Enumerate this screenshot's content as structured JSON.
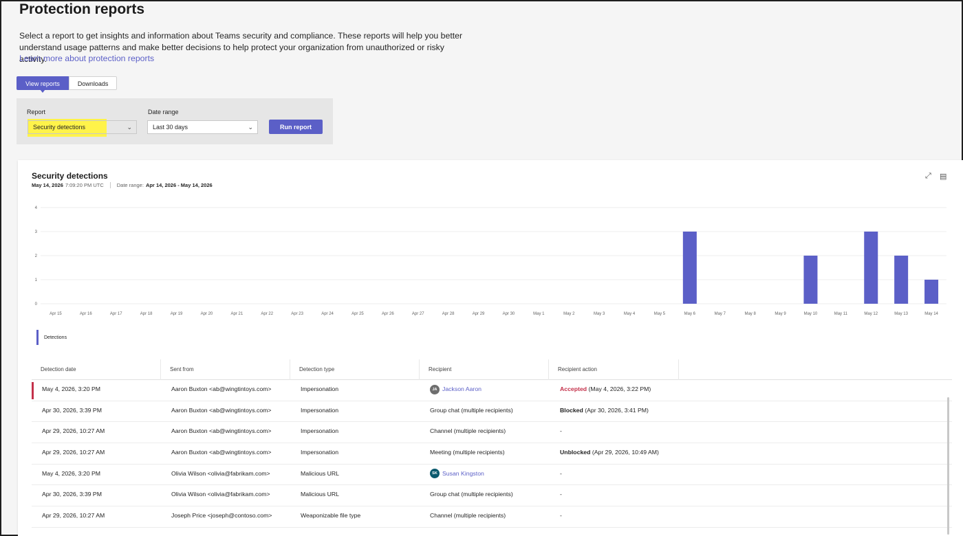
{
  "page": {
    "title": "Protection reports",
    "description": "Select a report to get insights and information about Teams security and compliance. These reports will help you better understand usage patterns and make better decisions to help protect your organization from unauthorized or risky activity.",
    "learn_more": "Learn more about protection reports"
  },
  "tabs": [
    {
      "label": "View reports",
      "active": true
    },
    {
      "label": "Downloads",
      "active": false
    }
  ],
  "filters": {
    "report_label": "Report",
    "report_value": "Security detections",
    "date_label": "Date range",
    "date_value": "Last 30 days",
    "run_label": "Run report",
    "highlight_color": "#fff34a"
  },
  "report": {
    "title": "Security detections",
    "generated_date": "May 14, 2026",
    "generated_time": "7:09:20 PM UTC",
    "date_range_label": "Date range:",
    "date_range_value": "Apr 14, 2026 - May 14, 2026",
    "icons": [
      "expand-icon",
      "export-excel-icon"
    ]
  },
  "chart_data": {
    "type": "bar",
    "categories": [
      "Apr 15",
      "Apr 16",
      "Apr 17",
      "Apr 18",
      "Apr 19",
      "Apr 20",
      "Apr 21",
      "Apr 22",
      "Apr 23",
      "Apr 24",
      "Apr 25",
      "Apr 26",
      "Apr 27",
      "Apr 28",
      "Apr 29",
      "Apr 30",
      "May 1",
      "May 2",
      "May 3",
      "May 4",
      "May 5",
      "May 6",
      "May 7",
      "May 8",
      "May 9",
      "May 10",
      "May 11",
      "May 12",
      "May 13",
      "May 14"
    ],
    "series": [
      {
        "name": "Detections",
        "values": [
          0,
          0,
          0,
          0,
          0,
          0,
          0,
          0,
          0,
          0,
          0,
          0,
          0,
          0,
          0,
          0,
          0,
          0,
          0,
          0,
          0,
          3,
          0,
          0,
          0,
          2,
          0,
          3,
          2,
          1
        ],
        "color": "#5b5fc7"
      }
    ],
    "yticks": [
      0,
      1,
      2,
      3,
      4
    ],
    "ylim": [
      0,
      4
    ],
    "grid": true,
    "legend": "bottom-left"
  },
  "table": {
    "columns": [
      "Detection date",
      "Sent from",
      "Detection type",
      "Recipient",
      "Recipient action"
    ],
    "rows": [
      {
        "date": "May 4, 2026, 3:20 PM",
        "from": "Aaron Buxton <ab@wingtintoys.com>",
        "type": "Impersonation",
        "recipient": "Jackson Aaron",
        "recipient_initials": "JA",
        "recipient_color": "#6e6e6e",
        "recipient_is_person": true,
        "action_status": "Accepted",
        "action_detail": "(May 4, 2026, 3:22 PM)",
        "selected": true
      },
      {
        "date": "Apr 30, 2026, 3:39 PM",
        "from": "Aaron Buxton <ab@wingtintoys.com>",
        "type": "Impersonation",
        "recipient": "Group chat (multiple recipients)",
        "recipient_is_person": false,
        "action_status": "Blocked",
        "action_detail": "(Apr 30, 2026, 3:41 PM)"
      },
      {
        "date": "Apr 29, 2026, 10:27 AM",
        "from": "Aaron Buxton <ab@wingtintoys.com>",
        "type": "Impersonation",
        "recipient": "Channel (multiple recipients)",
        "recipient_is_person": false,
        "action_status": "",
        "action_detail": "-"
      },
      {
        "date": "Apr 29, 2026, 10:27 AM",
        "from": "Aaron Buxton <ab@wingtintoys.com>",
        "type": "Impersonation",
        "recipient": "Meeting (multiple recipients)",
        "recipient_is_person": false,
        "action_status": "Unblocked",
        "action_detail": "(Apr 29, 2026, 10:49 AM)"
      },
      {
        "date": "May 4, 2026, 3:20 PM",
        "from": "Olivia Wilson <olivia@fabrikam.com>",
        "type": "Malicious URL",
        "recipient": "Susan Kingston",
        "recipient_initials": "SK",
        "recipient_color": "#0b5a6e",
        "recipient_is_person": true,
        "action_status": "",
        "action_detail": "-"
      },
      {
        "date": "Apr 30, 2026, 3:39 PM",
        "from": "Olivia Wilson <olivia@fabrikam.com>",
        "type": "Malicious URL",
        "recipient": "Group chat (multiple recipients)",
        "recipient_is_person": false,
        "action_status": "",
        "action_detail": "-"
      },
      {
        "date": "Apr 29, 2026, 10:27 AM",
        "from": "Joseph Price <joseph@contoso.com>",
        "type": "Weaponizable file type",
        "recipient": "Channel (multiple recipients)",
        "recipient_is_person": false,
        "action_status": "",
        "action_detail": "-"
      }
    ]
  },
  "colors": {
    "accent": "#5b5fc7",
    "accepted": "#c4314b"
  }
}
